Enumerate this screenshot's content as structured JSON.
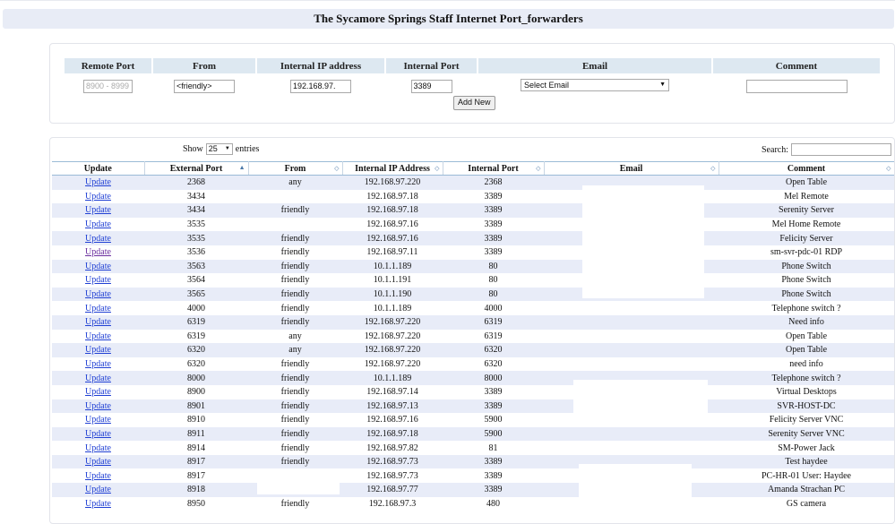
{
  "page": {
    "title": "The Sycamore Springs Staff Internet Port_forwarders"
  },
  "add_form": {
    "headers": [
      "Remote Port",
      "From",
      "Internal IP address",
      "Internal Port",
      "Email",
      "Comment"
    ],
    "remote_port_placeholder": "8900 - 8999",
    "from_value": "<friendly>",
    "internal_ip_value": "192.168.97.",
    "internal_port_value": "3389",
    "email_select": "Select Email",
    "comment_value": "",
    "add_button": "Add New"
  },
  "list": {
    "show_label": "Show",
    "show_value": "25",
    "entries_label": "entries",
    "search_label": "Search:",
    "columns": [
      "Update",
      "External Port",
      "From",
      "Internal IP Address",
      "Internal Port",
      "Email",
      "Comment"
    ],
    "update_label": "Update",
    "rows": [
      {
        "ext": "2368",
        "from": "any",
        "ip": "192.168.97.220",
        "port": "2368",
        "comment": "Open Table"
      },
      {
        "ext": "3434",
        "from": "",
        "ip": "192.168.97.18",
        "port": "3389",
        "comment": "Mel Remote"
      },
      {
        "ext": "3434",
        "from": "friendly",
        "ip": "192.168.97.18",
        "port": "3389",
        "comment": "Serenity Server"
      },
      {
        "ext": "3535",
        "from": "",
        "ip": "192.168.97.16",
        "port": "3389",
        "comment": "Mel Home Remote"
      },
      {
        "ext": "3535",
        "from": "friendly",
        "ip": "192.168.97.16",
        "port": "3389",
        "comment": "Felicity Server"
      },
      {
        "ext": "3536",
        "from": "friendly",
        "ip": "192.168.97.11",
        "port": "3389",
        "comment": "sm-svr-pdc-01 RDP"
      },
      {
        "ext": "3563",
        "from": "friendly",
        "ip": "10.1.1.189",
        "port": "80",
        "comment": "Phone Switch"
      },
      {
        "ext": "3564",
        "from": "friendly",
        "ip": "10.1.1.191",
        "port": "80",
        "comment": "Phone Switch"
      },
      {
        "ext": "3565",
        "from": "friendly",
        "ip": "10.1.1.190",
        "port": "80",
        "comment": "Phone Switch"
      },
      {
        "ext": "4000",
        "from": "friendly",
        "ip": "10.1.1.189",
        "port": "4000",
        "comment": "Telephone switch ?"
      },
      {
        "ext": "6319",
        "from": "friendly",
        "ip": "192.168.97.220",
        "port": "6319",
        "comment": "Need info"
      },
      {
        "ext": "6319",
        "from": "any",
        "ip": "192.168.97.220",
        "port": "6319",
        "comment": "Open Table"
      },
      {
        "ext": "6320",
        "from": "any",
        "ip": "192.168.97.220",
        "port": "6320",
        "comment": "Open Table"
      },
      {
        "ext": "6320",
        "from": "friendly",
        "ip": "192.168.97.220",
        "port": "6320",
        "comment": "need info"
      },
      {
        "ext": "8000",
        "from": "friendly",
        "ip": "10.1.1.189",
        "port": "8000",
        "comment": "Telephone switch ?"
      },
      {
        "ext": "8900",
        "from": "friendly",
        "ip": "192.168.97.14",
        "port": "3389",
        "comment": "Virtual Desktops"
      },
      {
        "ext": "8901",
        "from": "friendly",
        "ip": "192.168.97.13",
        "port": "3389",
        "comment": "SVR-HOST-DC"
      },
      {
        "ext": "8910",
        "from": "friendly",
        "ip": "192.168.97.16",
        "port": "5900",
        "comment": "Felicity Server VNC"
      },
      {
        "ext": "8911",
        "from": "friendly",
        "ip": "192.168.97.18",
        "port": "5900",
        "comment": "Serenity Server VNC"
      },
      {
        "ext": "8914",
        "from": "friendly",
        "ip": "192.168.97.82",
        "port": "81",
        "comment": "SM-Power Jack"
      },
      {
        "ext": "8917",
        "from": "friendly",
        "ip": "192.168.97.73",
        "port": "3389",
        "comment": "Test haydee"
      },
      {
        "ext": "8917",
        "from": "",
        "ip": "192.168.97.73",
        "port": "3389",
        "comment": "PC-HR-01 User: Haydee"
      },
      {
        "ext": "8918",
        "from": "",
        "ip": "192.168.97.77",
        "port": "3389",
        "comment": "Amanda Strachan PC"
      },
      {
        "ext": "8950",
        "from": "friendly",
        "ip": "192.168.97.3",
        "port": "480",
        "comment": "GS camera"
      }
    ]
  }
}
